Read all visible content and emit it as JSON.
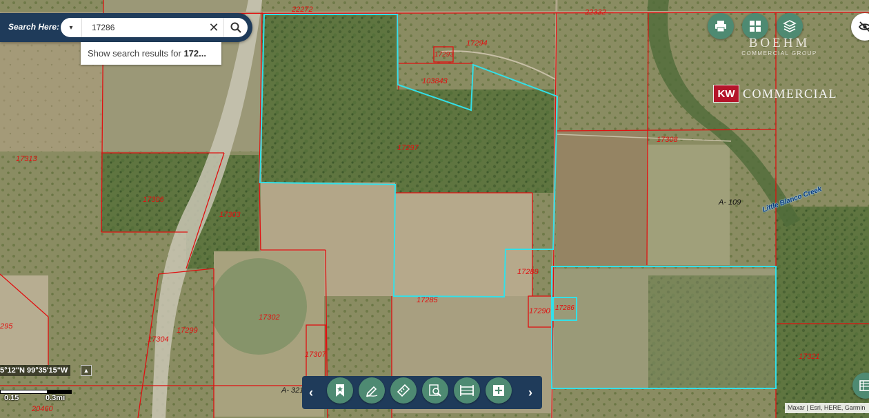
{
  "search": {
    "label": "Search Here:",
    "value": "17286",
    "suggestion_prefix": "Show search results for ",
    "suggestion_term": "172...",
    "dropdown_glyph": "▾",
    "clear_glyph": "✕"
  },
  "parcels": [
    {
      "id": "22272"
    },
    {
      "id": "22332"
    },
    {
      "id": "17294"
    },
    {
      "id": "17293"
    },
    {
      "id": "103843"
    },
    {
      "id": "17297"
    },
    {
      "id": "17308"
    },
    {
      "id": "17313"
    },
    {
      "id": "17306"
    },
    {
      "id": "17303"
    },
    {
      "id": "17288"
    },
    {
      "id": "17285"
    },
    {
      "id": "17290"
    },
    {
      "id": "17286"
    },
    {
      "id": "17302"
    },
    {
      "id": "17299"
    },
    {
      "id": "17304"
    },
    {
      "id": "17307"
    },
    {
      "id": "295"
    },
    {
      "id": "17321"
    },
    {
      "id": "20460"
    }
  ],
  "features": {
    "abstract_1": "A- 109",
    "abstract_2": "A- 321",
    "creek": "Little Blanco Creek"
  },
  "logos": {
    "boehm_name": "BOEHM",
    "boehm_sub": "COMMERCIAL GROUP",
    "kw_badge": "KW",
    "kw_text": "COMMERCIAL"
  },
  "coordinates": "5°12\"N 99°35'15\"W",
  "scale": {
    "label_1": "0.15",
    "label_2": "0.3mi"
  },
  "attribution": "Maxar | Esri, HERE, Garmin",
  "toolbar": {
    "prev": "‹",
    "next": "›",
    "tools": [
      "bookmark-icon",
      "draw-icon",
      "measure-icon",
      "identify-icon",
      "print-frame-icon",
      "add-data-icon"
    ]
  },
  "colors": {
    "parcel_line": "#e01010",
    "highlight": "#33e0e8",
    "button": "#4e8a72",
    "panel": "#1f3b5a"
  }
}
